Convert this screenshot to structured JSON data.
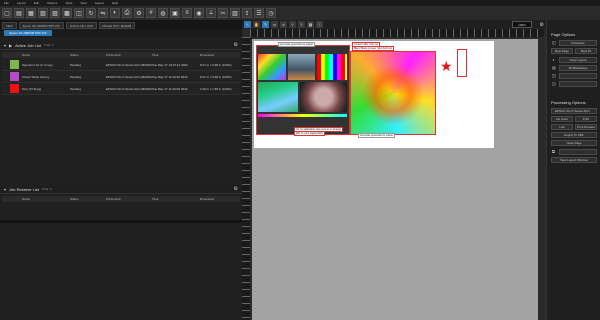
{
  "menu": [
    "File",
    "Layout",
    "Edit",
    "Options",
    "Tools",
    "View",
    "Layout",
    "Help"
  ],
  "tabs": [
    "Filter",
    "Epson SC-S80600 MTF P/F",
    "HOrsin HD / CMI",
    "Mimaki JFX / MultiHB"
  ],
  "subtab": "Epson SC-S80600 MTF P/F",
  "active_job_list": {
    "title": "Active Job List",
    "count": "Total: 3",
    "columns": [
      "Name",
      "Status",
      "Printer/Job",
      "Time",
      "Dimension"
    ],
    "rows": [
      {
        "name": "Spectrum Art w/ 4 copy",
        "status": "Pending",
        "printer": "EPSON SC-S Series Film (BGMI0...",
        "time": "Tue May 17 10:07:14 2022",
        "dim": "8.27 in x 5.98 in (100%)",
        "thumb": "#7fb64a"
      },
      {
        "name": "Clover White w/copy",
        "status": "Pending",
        "printer": "EPSON SC-S Series Film (BGMI0...",
        "time": "Tue May 17 11:29:20 2022",
        "dim": "8.27 in x 5.98 in (100%)",
        "thumb": "#b84ac8"
      },
      {
        "name": "Test_ST-M.jpg",
        "status": "Pending",
        "printer": "EPSON SC-S Series Film (BGMI0...",
        "time": "Tue May 17 11:29:09 2022",
        "dim": "1.00 in x 1.58 in (100%)",
        "thumb": "#e11"
      }
    ]
  },
  "job_reserve_list": {
    "title": "Job Reserve List",
    "count": "Total: 0",
    "columns": [
      "Name",
      "Status",
      "Printer/Job",
      "Time",
      "Dimension"
    ]
  },
  "canvas": {
    "zoom": "100%",
    "annotations": [
      "Generate generated to output",
      "Content after crop set",
      "Blend Mode (Linear, Spot Full Ink)",
      "Generate generated to output",
      "Ink no applicable: stay sure to re-arrange",
      "KIN on print digital AIDS"
    ]
  },
  "right_panel": {
    "page_options_title": "Page Options",
    "buttons": [
      "Fit/Center",
      "Best Page",
      "Best Fit",
      "Color Layout",
      "All Blanksheet"
    ],
    "processing_title": "Processing Options",
    "printer_select": "EPSON SC-S Series Film",
    "proc_buttons": [
      "Ink Color",
      "Print",
      "Link",
      "Print Preview",
      "Export To PDF",
      "Clear Page",
      "New Layout Window"
    ]
  }
}
